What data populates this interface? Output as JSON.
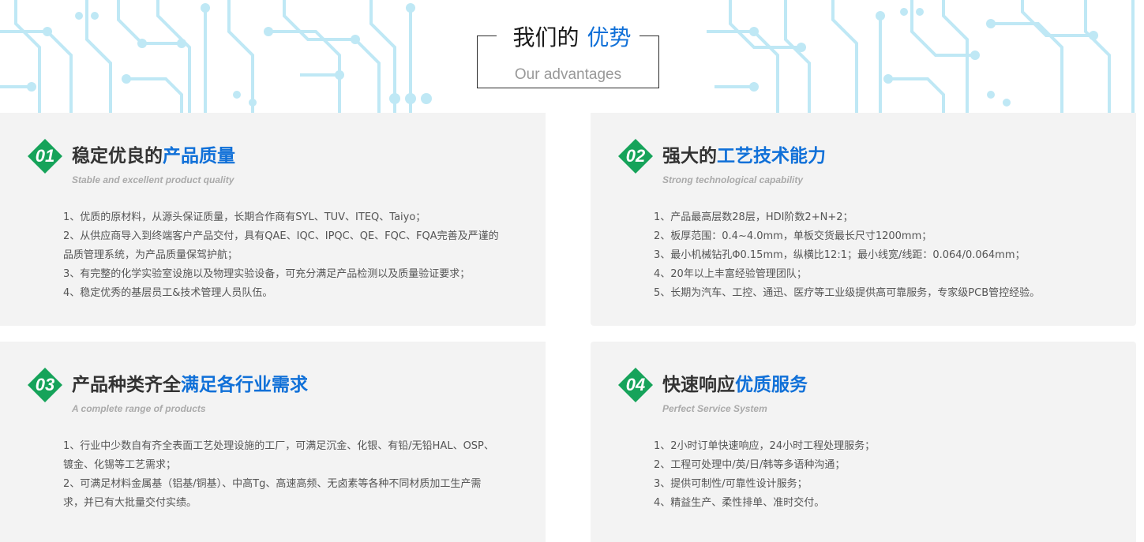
{
  "colors": {
    "accent_blue": "#1070d8",
    "badge_green": "#16a35a",
    "circuit": "#bfe8f5",
    "card_bg": "#f3f3f3"
  },
  "header": {
    "title_prefix": "我们的",
    "title_highlight": "优势",
    "subtitle": "Our advantages"
  },
  "cards": [
    {
      "number": "01",
      "title": "稳定优良的",
      "title_highlight": "产品质量",
      "subtitle": "Stable and excellent product quality",
      "items": [
        "1、优质的原材料，从源头保证质量，长期合作商有SYL、TUV、ITEQ、Taiyo；",
        "2、从供应商导入到终端客户产品交付，具有QAE、IQC、IPQC、QE、FQC、FQA完善及严谨的",
        "品质管理系统，为产品质量保驾护航；",
        "3、有完整的化学实验室设施以及物理实验设备，可充分满足产品检测以及质量验证要求；",
        "4、稳定优秀的基层员工&技术管理人员队伍。"
      ]
    },
    {
      "number": "02",
      "title": "强大的",
      "title_highlight": "工艺技术能力",
      "subtitle": "Strong technological capability",
      "items": [
        "1、产品最高层数28层，HDI阶数2+N+2；",
        "2、板厚范围：0.4~4.0mm，单板交货最长尺寸1200mm；",
        "3、最小机械钻孔Φ0.15mm，纵横比12:1；最小线宽/线距：0.064/0.064mm；",
        "4、20年以上丰富经验管理团队；",
        "5、长期为汽车、工控、通迅、医疗等工业级提供高可靠服务，专家级PCB管控经验。"
      ]
    },
    {
      "number": "03",
      "title": "产品种类齐全",
      "title_highlight": "满足各行业需求",
      "subtitle": "A complete range of products",
      "items": [
        "1、行业中少数自有齐全表面工艺处理设施的工厂，可满足沉金、化银、有铅/无铅HAL、OSP、",
        "镀金、化锡等工艺需求；",
        "2、可满足材料金属基（铝基/铜基）、中高Tg、高速高频、无卤素等各种不同材质加工生产需",
        "求，并已有大批量交付实绩。"
      ]
    },
    {
      "number": "04",
      "title": "快速响应",
      "title_highlight": "优质服务",
      "subtitle": "Perfect Service System",
      "items": [
        "1、2小时订单快速响应，24小时工程处理服务；",
        "2、工程可处理中/英/日/韩等多语种沟通；",
        "3、提供可制性/可靠性设计服务；",
        "4、精益生产、柔性排单、准时交付。"
      ]
    }
  ]
}
